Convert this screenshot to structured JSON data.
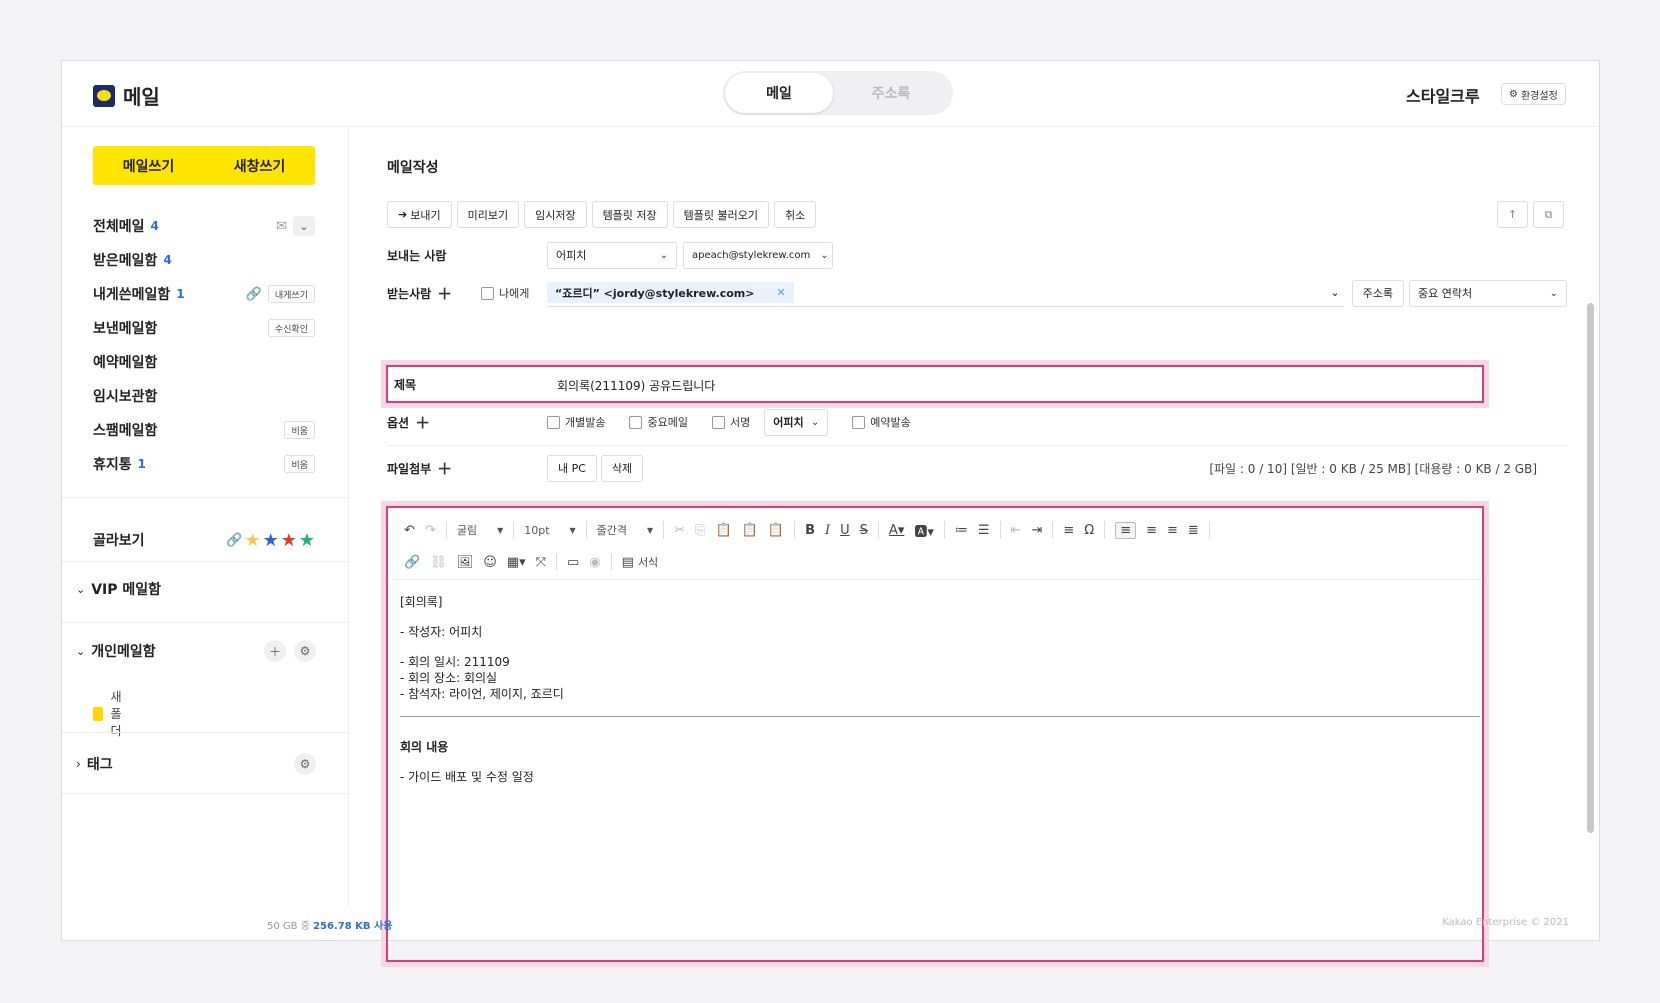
{
  "header": {
    "app_title": "메일",
    "tabs": [
      "메일",
      "주소록"
    ],
    "brand": "스타일크루",
    "settings_label": "환경설정"
  },
  "sidebar": {
    "compose_label": "메일쓰기",
    "compose_new_window_label": "새창쓰기",
    "mailboxes": [
      {
        "label": "전체메일",
        "count": "4"
      },
      {
        "label": "받은메일함",
        "count": "4"
      },
      {
        "label": "내게쓴메일함",
        "count": "1",
        "action": "내게쓰기"
      },
      {
        "label": "보낸메일함",
        "count": "",
        "action": "수신확인"
      },
      {
        "label": "예약메일함",
        "count": ""
      },
      {
        "label": "임시보관함",
        "count": ""
      },
      {
        "label": "스팸메일함",
        "count": "",
        "action": "비움"
      },
      {
        "label": "휴지통",
        "count": "1",
        "action": "비움"
      }
    ],
    "filter_label": "골라보기",
    "vip_label": "VIP 메일함",
    "personal_label": "개인메일함",
    "new_folder_label": "새 폴더",
    "tag_label": "태그"
  },
  "footer": {
    "usage_prefix": "50 GB 중",
    "usage_value": "256.78 KB 사용",
    "copyright": "Kakao Enterprise © 2021"
  },
  "compose": {
    "title": "메일작성",
    "toolbar": {
      "send": "보내기",
      "preview": "미리보기",
      "save_draft": "임시저장",
      "save_template": "템플릿 저장",
      "load_template": "템플릿 불러오기",
      "cancel": "취소"
    },
    "sender_label": "보내는 사람",
    "sender_name": "어피치",
    "sender_email": "apeach@stylekrew.com",
    "recipient_label": "받는사람",
    "to_me_label": "나에게",
    "recipient_chip": "“죠르디” <jordy@stylekrew.com>",
    "address_book_label": "주소록",
    "important_contacts_label": "중요 연락처",
    "subject_label": "제목",
    "subject_value": "회의록(211109) 공유드립니다",
    "options_label": "옵션",
    "options": {
      "individual": "개별발송",
      "important": "중요메일",
      "signature": "서명",
      "signature_name": "어피치",
      "scheduled": "예약발송"
    },
    "attach_label": "파일첨부",
    "attach_my_pc": "내 PC",
    "attach_delete": "삭제",
    "attach_info": "[파일 : 0 / 10] [일반 : 0 KB / 25 MB] [대용량 : 0 KB / 2 GB]"
  },
  "editor": {
    "font_name": "굴림",
    "font_size": "10pt",
    "line_height": "줄간격",
    "format_label": "서식",
    "body": {
      "l1": "[회의록]",
      "l2": "- 작성자: 어피치",
      "l3": "- 회의 일시: 211109",
      "l4": "- 회의 장소: 회의실",
      "l5": "- 참석자: 라이언, 제이지, 죠르디",
      "l6": "회의 내용",
      "l7": "- 가이드 배포 및 수정 일정"
    }
  },
  "colors": {
    "accent_yellow": "#ffe500",
    "highlight_pink": "#dc3d7a",
    "link_blue": "#2b6fd6"
  }
}
